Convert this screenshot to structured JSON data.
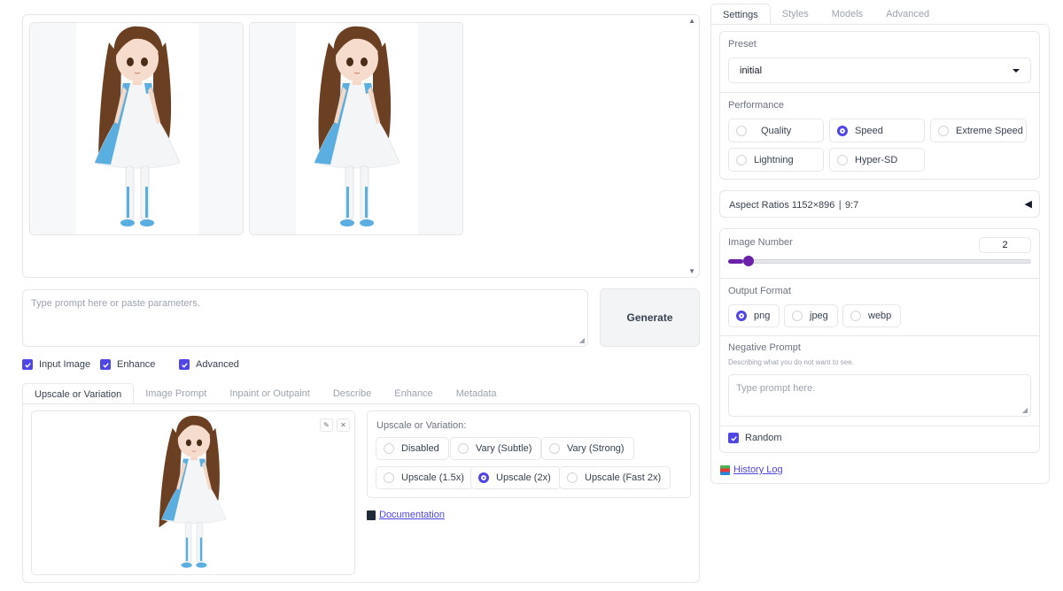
{
  "gallery": {
    "images": [
      "generated-image-1",
      "generated-image-2"
    ]
  },
  "prompt": {
    "placeholder": "Type prompt here or paste parameters."
  },
  "generate_label": "Generate",
  "options": [
    {
      "label": "Input Image",
      "checked": true
    },
    {
      "label": "Enhance",
      "checked": true
    },
    {
      "label": "Advanced",
      "checked": true
    }
  ],
  "left_tabs": [
    "Upscale or Variation",
    "Image Prompt",
    "Inpaint or Outpaint",
    "Describe",
    "Enhance",
    "Metadata"
  ],
  "upscale": {
    "title": "Upscale or Variation:",
    "options": [
      "Disabled",
      "Vary (Subtle)",
      "Vary (Strong)",
      "Upscale (1.5x)",
      "Upscale (2x)",
      "Upscale (Fast 2x)"
    ],
    "selected": "Upscale (2x)"
  },
  "documentation_label": "Documentation",
  "right_tabs": [
    "Settings",
    "Styles",
    "Models",
    "Advanced"
  ],
  "settings": {
    "preset_label": "Preset",
    "preset_value": "initial",
    "performance_label": "Performance",
    "performance_options": [
      "Quality",
      "Speed",
      "Extreme Speed",
      "Lightning",
      "Hyper-SD"
    ],
    "performance_selected": "Speed",
    "aspect_label": "Aspect Ratios 1152×896 ∣ 9:7",
    "image_number_label": "Image Number",
    "image_number_value": "2",
    "image_number_min": 1,
    "image_number_max": 32,
    "output_format_label": "Output Format",
    "output_formats": [
      "png",
      "jpeg",
      "webp"
    ],
    "output_selected": "png",
    "negative_label": "Negative Prompt",
    "negative_hint": "Describing what you do not want to see.",
    "negative_placeholder": "Type prompt here.",
    "random_label": "Random"
  },
  "history_label": "History Log",
  "colors": {
    "accent": "#4f46e5",
    "slider": "#6b21a8",
    "dress_blue": "#5aaee0"
  }
}
